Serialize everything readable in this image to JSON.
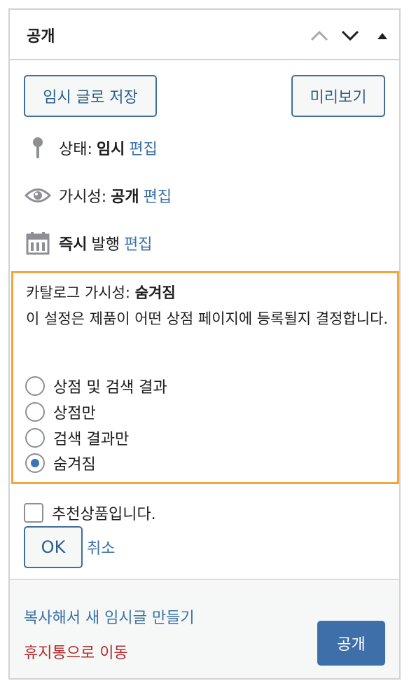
{
  "panel": {
    "title": "공개",
    "controls": [
      {
        "icon": "chevron-up-icon"
      },
      {
        "icon": "chevron-down-icon"
      },
      {
        "icon": "caret-up-icon"
      }
    ]
  },
  "actions": {
    "save_draft_label": "임시 글로 저장",
    "preview_label": "미리보기"
  },
  "status": {
    "icon": "pin-icon",
    "label": "상태:",
    "value": "임시",
    "edit_label": "편집"
  },
  "visibility": {
    "icon": "eye-icon",
    "label": "가시성:",
    "value": "공개",
    "edit_label": "편집"
  },
  "schedule": {
    "icon": "calendar-icon",
    "value": "즉시",
    "label": "발행",
    "edit_label": "편집"
  },
  "catalog": {
    "label": "카탈로그 가시성:",
    "value": "숨겨짐",
    "description": "이 설정은 제품이 어떤 상점 페이지에 등록될지 결정합니다.",
    "options": [
      {
        "label": "상점 및 검색 결과",
        "checked": false
      },
      {
        "label": "상점만",
        "checked": false
      },
      {
        "label": "검색 결과만",
        "checked": false
      },
      {
        "label": "숨겨짐",
        "checked": true
      }
    ],
    "featured_label": "추천상품입니다.",
    "featured_checked": false,
    "ok_label": "OK",
    "cancel_label": "취소"
  },
  "footer": {
    "duplicate_label": "복사해서 새 임시글 만들기",
    "trash_label": "휴지통으로 이동",
    "publish_label": "공개"
  },
  "colors": {
    "link": "#3a72a8",
    "trash": "#b32d2e",
    "primary": "#3f6fa8",
    "highlight_border": "#f0a73b"
  }
}
